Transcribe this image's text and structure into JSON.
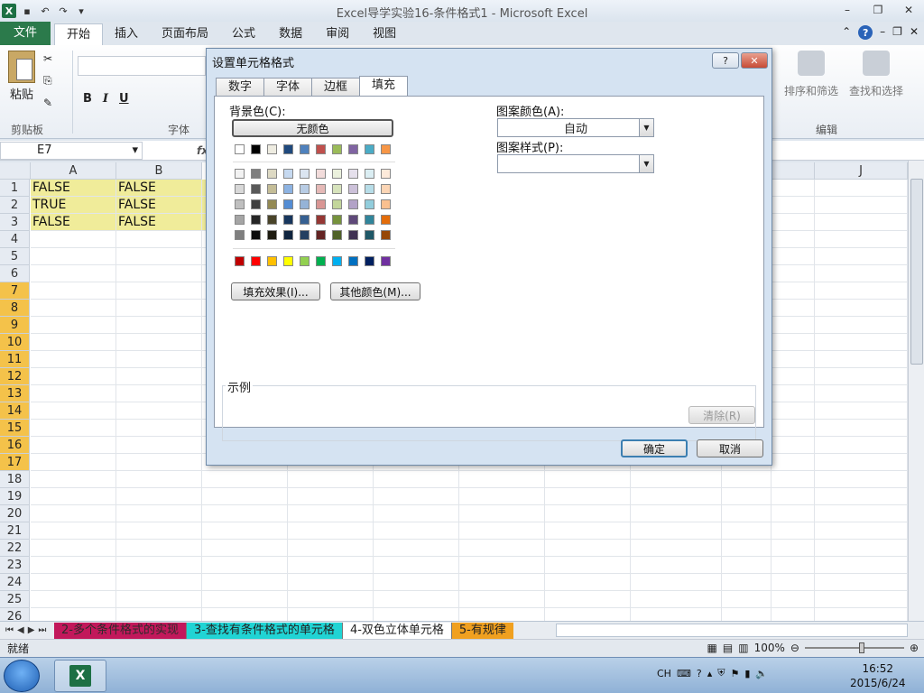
{
  "window": {
    "title": "Excel导学实验16-条件格式1 - Microsoft Excel",
    "minimize": "–",
    "restore": "❐",
    "close": "✕"
  },
  "qat": {
    "logo": "X",
    "save": "▪",
    "undo": "↶",
    "redo": "↷",
    "customize": "▾"
  },
  "ribbon_tabs": [
    "文件",
    "开始",
    "插入",
    "页面布局",
    "公式",
    "数据",
    "审阅",
    "视图"
  ],
  "ribbon": {
    "paste_label": "粘贴",
    "clipboard_group": "剪贴板",
    "font_group": "字体",
    "bold": "B",
    "italic": "I",
    "underline": "U",
    "sort_filter": "排序和筛选",
    "find_select": "查找和选择",
    "edit_group": "编辑"
  },
  "formula_bar": {
    "name_box": "E7",
    "fx": "fx"
  },
  "columns": [
    "A",
    "B",
    "J"
  ],
  "rows": [
    "1",
    "2",
    "3",
    "4",
    "5",
    "6",
    "7",
    "8",
    "9",
    "10",
    "11",
    "12",
    "13",
    "14",
    "15",
    "16",
    "17",
    "18",
    "19",
    "20",
    "21",
    "22",
    "23",
    "24",
    "25",
    "26"
  ],
  "cells": [
    [
      "FALSE",
      "FALSE"
    ],
    [
      "TRUE",
      "FALSE"
    ],
    [
      "FALSE",
      "FALSE"
    ]
  ],
  "sheet_tabs": [
    "2-多个条件格式的实现",
    "3-查找有条件格式的单元格",
    "4-双色立体单元格",
    "5-有规律"
  ],
  "status": {
    "text": "就绪",
    "zoom": "100%"
  },
  "taskbar": {
    "lang": "CH",
    "time": "16:52",
    "date": "2015/6/24"
  },
  "dialog": {
    "title": "设置单元格格式",
    "help": "?",
    "close": "✕",
    "tabs": [
      "数字",
      "字体",
      "边框",
      "填充"
    ],
    "active_tab": "填充",
    "bg_color_label": "背景色(C):",
    "no_color": "无颜色",
    "fill_effects": "填充效果(I)...",
    "more_colors": "其他颜色(M)...",
    "pattern_color_label": "图案颜色(A):",
    "pattern_color_value": "自动",
    "pattern_style_label": "图案样式(P):",
    "sample_label": "示例",
    "clear": "清除(R)",
    "ok": "确定",
    "cancel": "取消"
  },
  "palette": {
    "theme_top": [
      "#ffffff",
      "#000000",
      "#eeece1",
      "#1f497d",
      "#4f81bd",
      "#c0504d",
      "#9bbb59",
      "#8064a2",
      "#4bacc6",
      "#f79646"
    ],
    "theme_shades": [
      [
        "#f2f2f2",
        "#7f7f7f",
        "#ddd9c3",
        "#c6d9f0",
        "#dbe5f1",
        "#f2dcdb",
        "#ebf1dd",
        "#e5e0ec",
        "#dbeef3",
        "#fdeada"
      ],
      [
        "#d8d8d8",
        "#595959",
        "#c4bd97",
        "#8db3e2",
        "#b8cce4",
        "#e5b9b7",
        "#d7e3bc",
        "#ccc1d9",
        "#b7dde8",
        "#fbd5b5"
      ],
      [
        "#bfbfbf",
        "#3f3f3f",
        "#938953",
        "#548dd4",
        "#95b3d7",
        "#d99694",
        "#c3d69b",
        "#b2a2c7",
        "#92cddc",
        "#fac08f"
      ],
      [
        "#a5a5a5",
        "#262626",
        "#494429",
        "#17365d",
        "#366092",
        "#953734",
        "#76923c",
        "#5f497a",
        "#31859b",
        "#e36c09"
      ],
      [
        "#7f7f7f",
        "#0c0c0c",
        "#1d1b10",
        "#0f243e",
        "#244061",
        "#632423",
        "#4f6128",
        "#3f3151",
        "#205867",
        "#974806"
      ]
    ],
    "standard": [
      "#c00000",
      "#ff0000",
      "#ffc000",
      "#ffff00",
      "#92d050",
      "#00b050",
      "#00b0f0",
      "#0070c0",
      "#002060",
      "#7030a0"
    ]
  }
}
